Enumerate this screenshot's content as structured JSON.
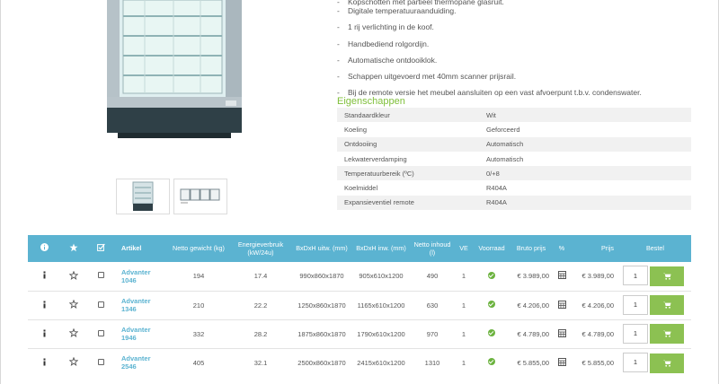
{
  "features": [
    "Kopschotten met partieel thermopane glasruit.",
    "Digitale temperatuuraanduiding.",
    "1 rij verlichting in de koof.",
    "Handbediend rolgordijn.",
    "Automatische ontdooiklok.",
    "Schappen uitgevoerd met 40mm scanner prijsrail.",
    "Bij de remote versie het meubel aansluiten op een vast afvoerpunt t.b.v. condenswater."
  ],
  "eigenschappen_title": "Eigenschappen",
  "specs": [
    {
      "label": "Standaardkleur",
      "value": "Wit"
    },
    {
      "label": "Koeling",
      "value": "Geforceerd"
    },
    {
      "label": "Ontdooiing",
      "value": "Automatisch"
    },
    {
      "label": "Lekwaterverdamping",
      "value": "Automatisch"
    },
    {
      "label": "Temperatuurbereik (ºC)",
      "value": "0/+8"
    },
    {
      "label": "Koelmiddel",
      "value": "R404A"
    },
    {
      "label": "Expansieventiel remote",
      "value": "R404A"
    }
  ],
  "table": {
    "headers": {
      "info_icon": "info-icon",
      "favorite_icon": "star-icon",
      "select_icon": "checkbox-icon",
      "artikel": "Artikel",
      "netto_gewicht": "Netto gewicht (kg)",
      "energie": "Energieverbruik (kW/24u)",
      "uitw": "BxDxH uitw. (mm)",
      "inw": "BxDxH inw. (mm)",
      "inhoud": "Netto inhoud (l)",
      "ve": "VE",
      "voorraad": "Voorraad",
      "bruto": "Bruto prijs",
      "pct": "%",
      "prijs": "Prijs",
      "bestel": "Bestel"
    },
    "rows": [
      {
        "artikel": "Advanter 1046",
        "gewicht": "194",
        "energie": "17.4",
        "uitw": "990x860x1870",
        "inw": "905x610x1200",
        "inhoud": "490",
        "ve": "1",
        "bruto": "€ 3.989,00",
        "prijs": "€ 3.989,00",
        "qty": "1"
      },
      {
        "artikel": "Advanter 1346",
        "gewicht": "210",
        "energie": "22.2",
        "uitw": "1250x860x1870",
        "inw": "1165x610x1200",
        "inhoud": "630",
        "ve": "1",
        "bruto": "€ 4.206,00",
        "prijs": "€ 4.206,00",
        "qty": "1"
      },
      {
        "artikel": "Advanter 1946",
        "gewicht": "332",
        "energie": "28.2",
        "uitw": "1875x860x1870",
        "inw": "1790x610x1200",
        "inhoud": "970",
        "ve": "1",
        "bruto": "€ 4.789,00",
        "prijs": "€ 4.789,00",
        "qty": "1"
      },
      {
        "artikel": "Advanter 2546",
        "gewicht": "405",
        "energie": "32.1",
        "uitw": "2500x860x1870",
        "inw": "2415x610x1200",
        "inhoud": "1310",
        "ve": "1",
        "bruto": "€ 5.855,00",
        "prijs": "€ 5.855,00",
        "qty": "1"
      }
    ]
  },
  "colors": {
    "header_bg": "#5bb3d1",
    "accent_green": "#8cc152",
    "title_green": "#7fbf3a",
    "link_blue": "#5bb3d1"
  }
}
